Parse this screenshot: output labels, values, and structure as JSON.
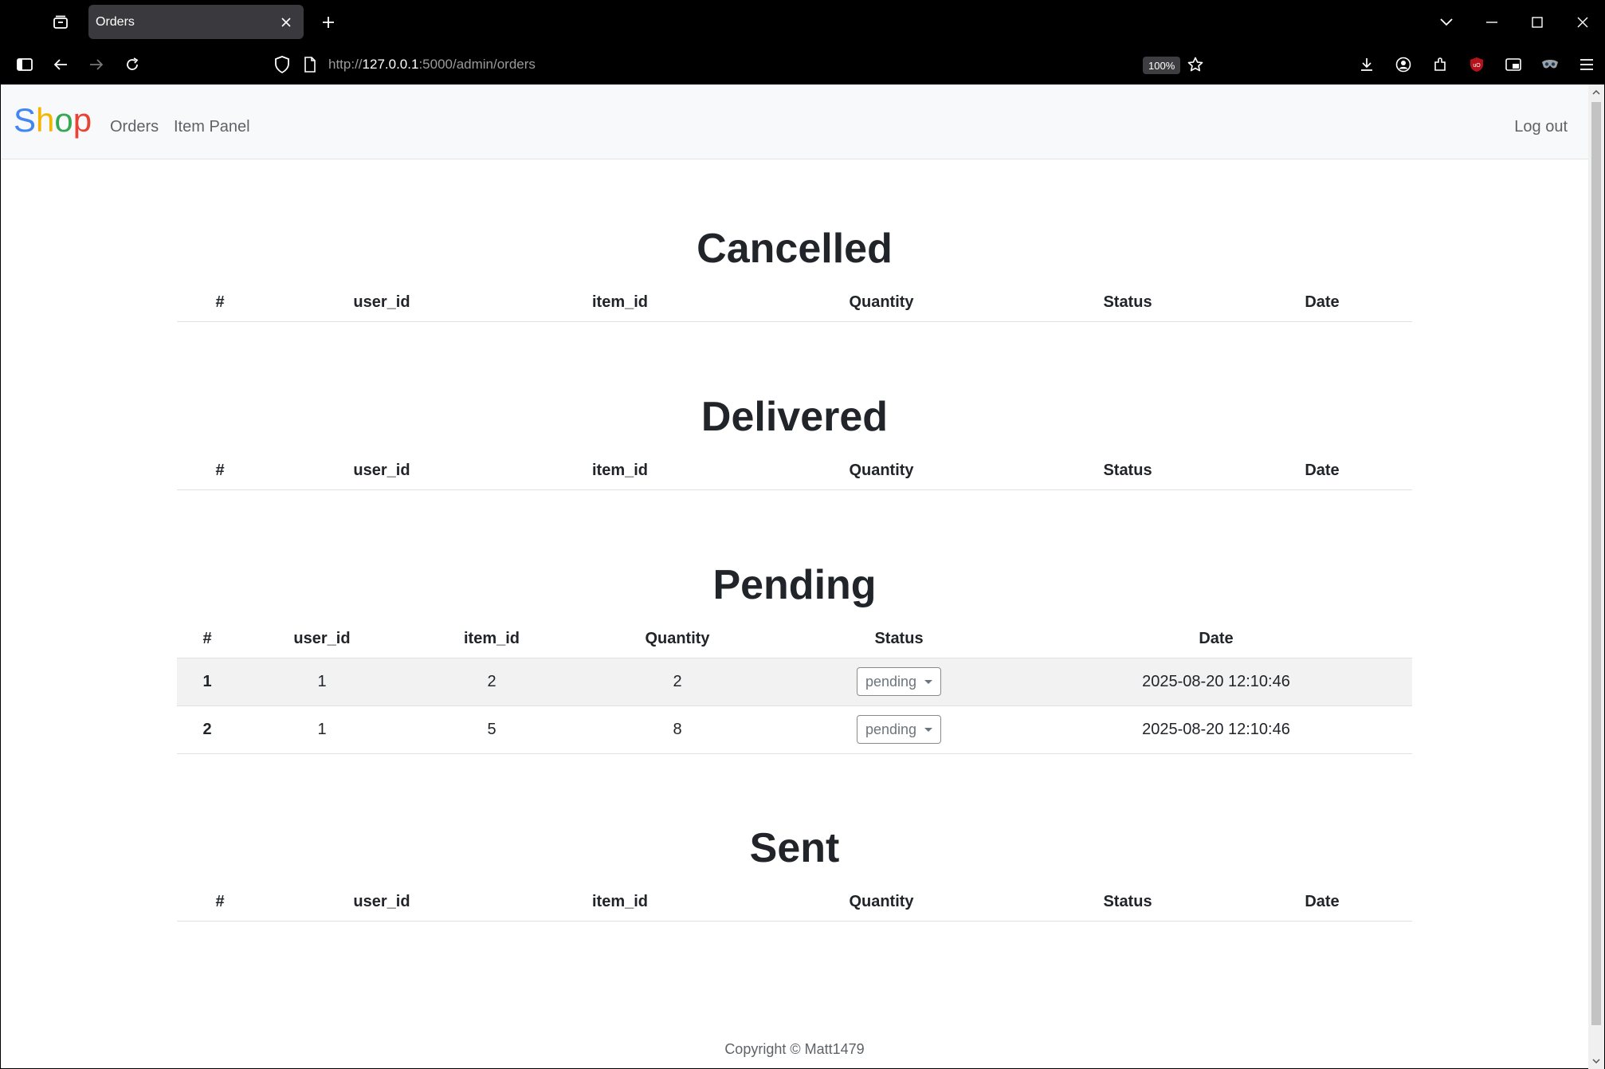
{
  "browser": {
    "tab_title": "Orders",
    "url_prefix": "http://",
    "url_host": "127.0.0.1",
    "url_rest": ":5000/admin/orders",
    "zoom": "100%"
  },
  "site": {
    "brand": [
      "S",
      "h",
      "o",
      "p"
    ],
    "nav": {
      "orders": "Orders",
      "item_panel": "Item Panel",
      "logout": "Log out"
    },
    "footer": "Copyright © Matt1479"
  },
  "sections": {
    "cancelled": {
      "title": "Cancelled"
    },
    "delivered": {
      "title": "Delivered"
    },
    "pending": {
      "title": "Pending"
    },
    "sent": {
      "title": "Sent"
    }
  },
  "columns": [
    "#",
    "user_id",
    "item_id",
    "Quantity",
    "Status",
    "Date"
  ],
  "pending_rows": [
    {
      "id": "1",
      "user_id": "1",
      "item_id": "2",
      "quantity": "2",
      "status": "pending",
      "date": "2025-08-20 12:10:46"
    },
    {
      "id": "2",
      "user_id": "1",
      "item_id": "5",
      "quantity": "8",
      "status": "pending",
      "date": "2025-08-20 12:10:46"
    }
  ],
  "colors": {
    "brand_blue": "#4285F4",
    "brand_yellow": "#F4B400",
    "brand_green": "#34A853",
    "brand_red": "#EA4335"
  }
}
